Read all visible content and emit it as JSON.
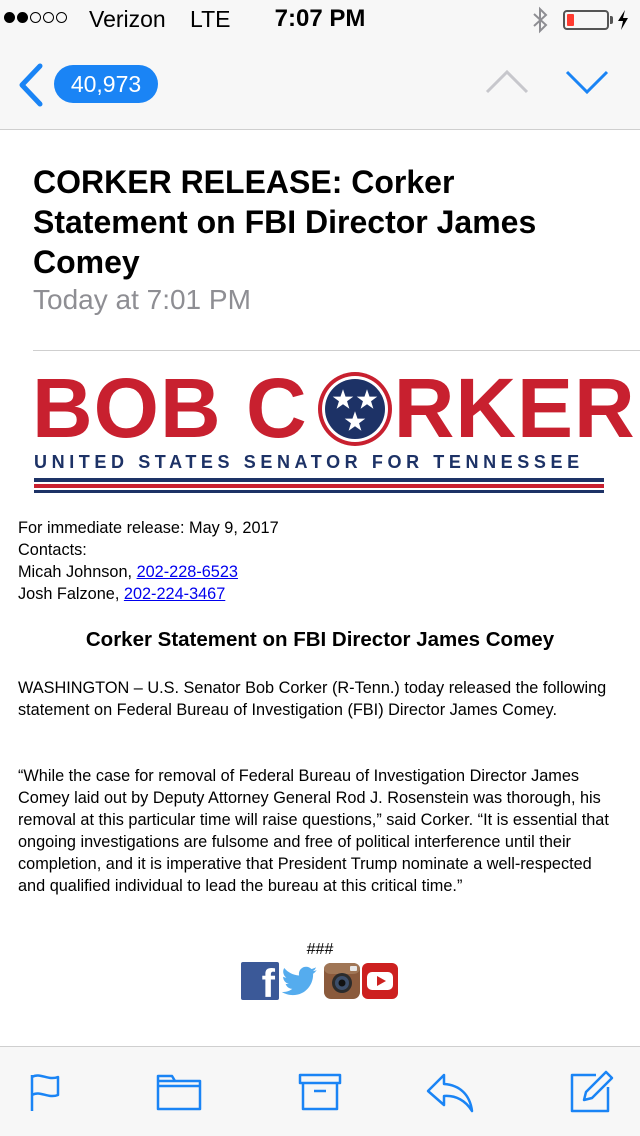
{
  "status_bar": {
    "signal_bars_filled": 2,
    "signal_bars_total": 5,
    "carrier": "Verizon",
    "network": "LTE",
    "time": "7:07 PM",
    "battery_level": 0.18,
    "battery_color": "#ff3b30",
    "icons": [
      "bluetooth-icon",
      "battery-icon",
      "charging-bolt-icon"
    ]
  },
  "nav": {
    "back_icon": "chevron-left-icon",
    "unread_count": "40,973",
    "accent_color": "#1a84f5",
    "prev_icon": "chevron-up-icon",
    "next_icon": "chevron-down-icon"
  },
  "message": {
    "subject": "CORKER RELEASE: Corker Statement on FBI Director James Comey",
    "date": "Today at 7:01 PM"
  },
  "logo": {
    "name_left": "BOB",
    "name_c": "C",
    "name_right": "RKER",
    "subtitle": "UNITED STATES SENATOR FOR TENNESSEE",
    "red": "#c8202f",
    "navy": "#1d3266"
  },
  "release": {
    "line": "For immediate release: May 9, 2017",
    "contacts_label": "Contacts:",
    "contacts": [
      {
        "name": "Micah Johnson, ",
        "phone": "202-228-6523"
      },
      {
        "name": "Josh Falzone, ",
        "phone": "202-224-3467"
      }
    ]
  },
  "body": {
    "headline": "Corker Statement on FBI Director James Comey",
    "para1": "WASHINGTON – U.S. Senator Bob Corker (R-Tenn.) today released the following statement on Federal Bureau of Investigation (FBI) Director James Comey.",
    "para2": "“While the case for removal of Federal Bureau of Investigation Director James Comey laid out by Deputy Attorney General Rod J. Rosenstein was thorough, his removal at this particular time will raise questions,” said Corker. “It is essential that ongoing investigations are fulsome and free of political interference until their completion, and it is imperative that President Trump nominate a well-respected and qualified individual to lead the bureau at this critical time.”",
    "end_mark": "###",
    "social_icons": [
      "facebook-icon",
      "twitter-icon",
      "instagram-icon",
      "youtube-icon"
    ]
  },
  "toolbar": {
    "tools": [
      "flag-icon",
      "folder-icon",
      "archive-icon",
      "reply-icon",
      "compose-icon"
    ]
  }
}
